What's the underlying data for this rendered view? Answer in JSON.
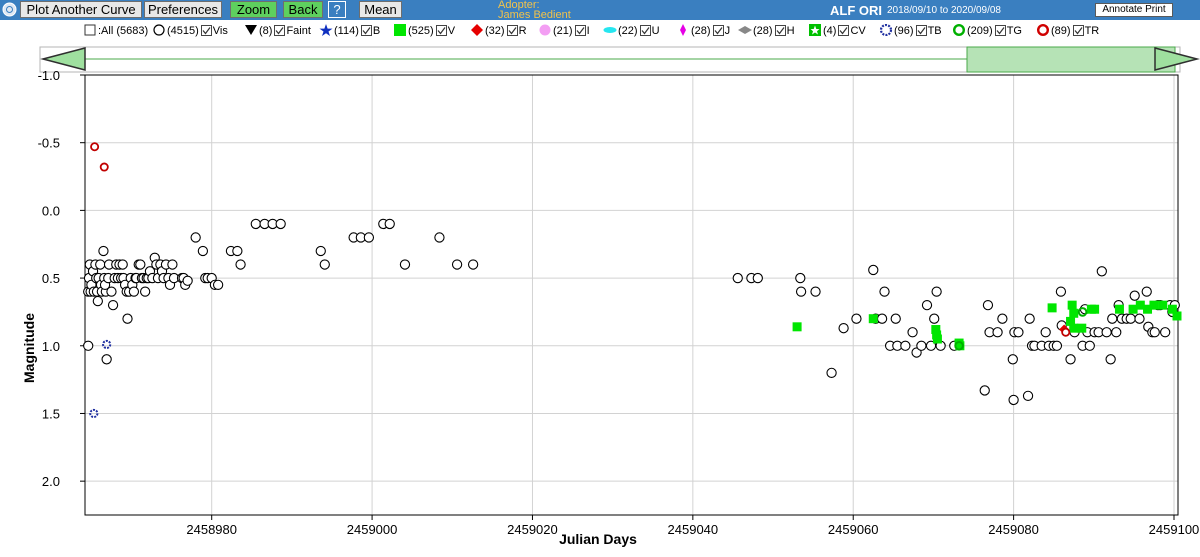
{
  "toolbar": {
    "buttons": {
      "plot_another": "Plot Another Curve",
      "preferences": "Preferences",
      "zoom": "Zoom",
      "back": "Back",
      "help": "?",
      "mean": "Mean"
    },
    "adopter_label": "Adopter:",
    "adopter_name": "James Bedient",
    "star_name": "ALF ORI",
    "date_range": "2018/09/10 to 2020/09/08",
    "annotate_print": "Annotate Print",
    "colors": {
      "bar": "#3a7fc0",
      "button_active": "#5ed05e",
      "adopter": "#f3c34a"
    }
  },
  "legend": [
    {
      "symbol": "checkbox",
      "label": ":All (5683)"
    },
    {
      "symbol": "open-circle",
      "label": "(4515)",
      "check_label": "Vis"
    },
    {
      "symbol": "filled-triangle-down",
      "label": "(8)",
      "check_label": "Faint"
    },
    {
      "symbol": "star",
      "label": "(114)",
      "check_label": "B"
    },
    {
      "symbol": "green-square",
      "label": "(525)",
      "check_label": "V"
    },
    {
      "symbol": "red-diamond",
      "label": "(32)",
      "check_label": "R"
    },
    {
      "symbol": "pink-circle",
      "label": "(21)",
      "check_label": "I"
    },
    {
      "symbol": "cyan-ellipse",
      "label": "(22)",
      "check_label": "U"
    },
    {
      "symbol": "magenta-diamond",
      "label": "(28)",
      "check_label": "J"
    },
    {
      "symbol": "gray-diamond",
      "label": "(28)",
      "check_label": "H"
    },
    {
      "symbol": "green-star",
      "label": "(4)",
      "check_label": "CV"
    },
    {
      "symbol": "blue-open-star",
      "label": "(96)",
      "check_label": "TB"
    },
    {
      "symbol": "green-open-circle",
      "label": "(209)",
      "check_label": "TG"
    },
    {
      "symbol": "red-open-circle",
      "label": "(89)",
      "check_label": "TR"
    }
  ],
  "chart_data": {
    "type": "scatter",
    "xlabel": "Julian Days",
    "ylabel": "Magnitude",
    "xlim": [
      2458964.2,
      2459100.5
    ],
    "ylim": [
      -1.0,
      2.25
    ],
    "y_inverted": true,
    "grid": true,
    "xticks": [
      2458980,
      2459000,
      2459020,
      2459040,
      2459060,
      2459080,
      2459100
    ],
    "yticks": [
      -1.0,
      -0.5,
      0.0,
      0.5,
      1.0,
      1.5,
      2.0
    ],
    "ytick_labels": [
      "-1.0",
      "-0.5",
      "0.0",
      "0.5",
      "1.0",
      "1.5",
      "2.0"
    ],
    "series": [
      {
        "name": "Vis",
        "marker": "open-circle",
        "color": "#000000",
        "points": [
          [
            2458964.6,
            1.0
          ],
          [
            2458964.6,
            0.6
          ],
          [
            2458964.7,
            0.5
          ],
          [
            2458964.8,
            0.4
          ],
          [
            2458964.9,
            0.6
          ],
          [
            2458965.0,
            0.55
          ],
          [
            2458965.2,
            0.45
          ],
          [
            2458965.3,
            0.6
          ],
          [
            2458965.5,
            0.4
          ],
          [
            2458965.6,
            0.5
          ],
          [
            2458965.7,
            0.6
          ],
          [
            2458965.8,
            0.67
          ],
          [
            2458965.9,
            0.5
          ],
          [
            2458966.1,
            0.4
          ],
          [
            2458966.2,
            0.55
          ],
          [
            2458966.3,
            0.6
          ],
          [
            2458966.5,
            0.3
          ],
          [
            2458966.6,
            0.5
          ],
          [
            2458966.8,
            0.6
          ],
          [
            2458966.7,
            0.55
          ],
          [
            2458966.9,
            1.1
          ],
          [
            2458967.1,
            0.5
          ],
          [
            2458967.2,
            0.4
          ],
          [
            2458967.5,
            0.6
          ],
          [
            2458967.7,
            0.7
          ],
          [
            2458967.9,
            0.5
          ],
          [
            2458968.1,
            0.4
          ],
          [
            2458968.3,
            0.5
          ],
          [
            2458968.5,
            0.4
          ],
          [
            2458968.7,
            0.5
          ],
          [
            2458968.9,
            0.4
          ],
          [
            2458969.0,
            0.5
          ],
          [
            2458969.2,
            0.55
          ],
          [
            2458969.4,
            0.6
          ],
          [
            2458969.5,
            0.8
          ],
          [
            2458969.7,
            0.6
          ],
          [
            2458969.9,
            0.5
          ],
          [
            2458970.1,
            0.55
          ],
          [
            2458970.3,
            0.6
          ],
          [
            2458970.5,
            0.5
          ],
          [
            2458970.6,
            0.5
          ],
          [
            2458970.9,
            0.4
          ],
          [
            2458971.1,
            0.4
          ],
          [
            2458971.3,
            0.5
          ],
          [
            2458971.5,
            0.5
          ],
          [
            2458971.7,
            0.6
          ],
          [
            2458971.9,
            0.5
          ],
          [
            2458972.1,
            0.5
          ],
          [
            2458972.3,
            0.45
          ],
          [
            2458972.6,
            0.5
          ],
          [
            2458972.9,
            0.35
          ],
          [
            2458973.1,
            0.4
          ],
          [
            2458973.3,
            0.5
          ],
          [
            2458973.6,
            0.4
          ],
          [
            2458973.8,
            0.45
          ],
          [
            2458974.0,
            0.5
          ],
          [
            2458974.3,
            0.4
          ],
          [
            2458974.6,
            0.5
          ],
          [
            2458974.8,
            0.55
          ],
          [
            2458975.1,
            0.4
          ],
          [
            2458975.3,
            0.5
          ],
          [
            2458976.3,
            0.5
          ],
          [
            2458976.5,
            0.5
          ],
          [
            2458976.7,
            0.55
          ],
          [
            2458977.0,
            0.52
          ],
          [
            2458978.0,
            0.2
          ],
          [
            2458978.9,
            0.3
          ],
          [
            2458979.2,
            0.5
          ],
          [
            2458979.5,
            0.5
          ],
          [
            2458980.0,
            0.5
          ],
          [
            2458980.4,
            0.55
          ],
          [
            2458980.8,
            0.55
          ],
          [
            2458982.4,
            0.3
          ],
          [
            2458983.2,
            0.3
          ],
          [
            2458983.6,
            0.4
          ],
          [
            2458985.5,
            0.1
          ],
          [
            2458986.6,
            0.1
          ],
          [
            2458987.6,
            0.1
          ],
          [
            2458988.6,
            0.1
          ],
          [
            2458993.6,
            0.3
          ],
          [
            2458994.1,
            0.4
          ],
          [
            2458997.7,
            0.2
          ],
          [
            2458998.6,
            0.2
          ],
          [
            2458999.6,
            0.2
          ],
          [
            2459001.4,
            0.1
          ],
          [
            2459002.2,
            0.1
          ],
          [
            2459004.1,
            0.4
          ],
          [
            2459008.4,
            0.2
          ],
          [
            2459010.6,
            0.4
          ],
          [
            2459012.6,
            0.4
          ],
          [
            2459045.6,
            0.5
          ],
          [
            2459047.3,
            0.5
          ],
          [
            2459048.1,
            0.5
          ],
          [
            2459053.4,
            0.5
          ],
          [
            2459053.5,
            0.6
          ],
          [
            2459055.3,
            0.6
          ],
          [
            2459057.3,
            1.2
          ],
          [
            2459058.8,
            0.87
          ],
          [
            2459060.4,
            0.8
          ],
          [
            2459062.5,
            0.44
          ],
          [
            2459062.8,
            0.8
          ],
          [
            2459063.6,
            0.8
          ],
          [
            2459063.9,
            0.6
          ],
          [
            2459064.6,
            1.0
          ],
          [
            2459065.3,
            0.8
          ],
          [
            2459065.5,
            1.0
          ],
          [
            2459066.5,
            1.0
          ],
          [
            2459067.4,
            0.9
          ],
          [
            2459067.9,
            1.05
          ],
          [
            2459068.5,
            1.0
          ],
          [
            2459069.2,
            0.7
          ],
          [
            2459069.7,
            1.0
          ],
          [
            2459070.1,
            0.8
          ],
          [
            2459070.4,
            0.6
          ],
          [
            2459070.9,
            1.0
          ],
          [
            2459072.6,
            1.0
          ],
          [
            2459076.4,
            1.33
          ],
          [
            2459076.8,
            0.7
          ],
          [
            2459077.0,
            0.9
          ],
          [
            2459078.0,
            0.9
          ],
          [
            2459078.6,
            0.8
          ],
          [
            2459079.9,
            1.1
          ],
          [
            2459080.0,
            1.4
          ],
          [
            2459080.1,
            0.9
          ],
          [
            2459080.6,
            0.9
          ],
          [
            2459081.8,
            1.37
          ],
          [
            2459082.0,
            0.8
          ],
          [
            2459082.3,
            1.0
          ],
          [
            2459082.6,
            1.0
          ],
          [
            2459083.5,
            1.0
          ],
          [
            2459084.0,
            0.9
          ],
          [
            2459084.4,
            1.0
          ],
          [
            2459085.0,
            1.0
          ],
          [
            2459085.4,
            1.0
          ],
          [
            2459085.9,
            0.6
          ],
          [
            2459086.0,
            0.85
          ],
          [
            2459087.1,
            1.1
          ],
          [
            2459087.6,
            0.9
          ],
          [
            2459088.6,
            1.0
          ],
          [
            2459088.9,
            0.73
          ],
          [
            2459089.2,
            0.9
          ],
          [
            2459089.5,
            1.0
          ],
          [
            2459090.1,
            0.9
          ],
          [
            2459090.6,
            0.9
          ],
          [
            2459091.0,
            0.45
          ],
          [
            2459091.6,
            0.9
          ],
          [
            2459092.1,
            1.1
          ],
          [
            2459092.3,
            0.8
          ],
          [
            2459092.8,
            0.9
          ],
          [
            2459093.1,
            0.7
          ],
          [
            2459093.5,
            0.8
          ],
          [
            2459094.1,
            0.8
          ],
          [
            2459094.6,
            0.8
          ],
          [
            2459095.1,
            0.63
          ],
          [
            2459095.7,
            0.8
          ],
          [
            2459096.6,
            0.6
          ],
          [
            2459096.8,
            0.86
          ],
          [
            2459097.3,
            0.9
          ],
          [
            2459097.6,
            0.9
          ],
          [
            2459098.0,
            0.7
          ],
          [
            2459098.3,
            0.7
          ],
          [
            2459098.9,
            0.9
          ],
          [
            2459099.5,
            0.7
          ],
          [
            2459099.8,
            0.75
          ],
          [
            2459100.1,
            0.7
          ]
        ]
      },
      {
        "name": "V",
        "marker": "green-square",
        "color": "#00e600",
        "points": [
          [
            2459053.0,
            0.86
          ],
          [
            2459062.5,
            0.8
          ],
          [
            2459070.3,
            0.88
          ],
          [
            2459070.4,
            0.92
          ],
          [
            2459070.5,
            0.95
          ],
          [
            2459073.2,
            0.98
          ],
          [
            2459073.3,
            1.0
          ],
          [
            2459084.8,
            0.72
          ],
          [
            2459087.1,
            0.82
          ],
          [
            2459087.3,
            0.7
          ],
          [
            2459087.5,
            0.76
          ],
          [
            2459087.5,
            0.87
          ],
          [
            2459088.5,
            0.87
          ],
          [
            2459089.7,
            0.73
          ],
          [
            2459090.1,
            0.73
          ],
          [
            2459093.2,
            0.73
          ],
          [
            2459094.9,
            0.73
          ],
          [
            2459095.8,
            0.7
          ],
          [
            2459096.7,
            0.73
          ],
          [
            2459097.5,
            0.7
          ],
          [
            2459098.6,
            0.7
          ],
          [
            2459099.8,
            0.73
          ],
          [
            2459100.5,
            0.78
          ]
        ]
      },
      {
        "name": "R",
        "marker": "red-diamond",
        "color": "#e60000",
        "points": [
          [
            2459086.3,
            0.88
          ]
        ]
      },
      {
        "name": "TB",
        "marker": "blue-open-star",
        "color": "#1f2fa0",
        "points": [
          [
            2458965.3,
            1.5
          ],
          [
            2458966.9,
            0.99
          ]
        ]
      },
      {
        "name": "TG",
        "marker": "green-open-circle",
        "color": "#00b000",
        "points": [
          [
            2459073.2,
            1.0
          ],
          [
            2459088.6,
            0.75
          ]
        ]
      },
      {
        "name": "TR",
        "marker": "red-open-circle",
        "color": "#c00000",
        "points": [
          [
            2458965.4,
            -0.47
          ],
          [
            2458966.6,
            -0.32
          ],
          [
            2459086.5,
            0.9
          ]
        ]
      }
    ]
  }
}
